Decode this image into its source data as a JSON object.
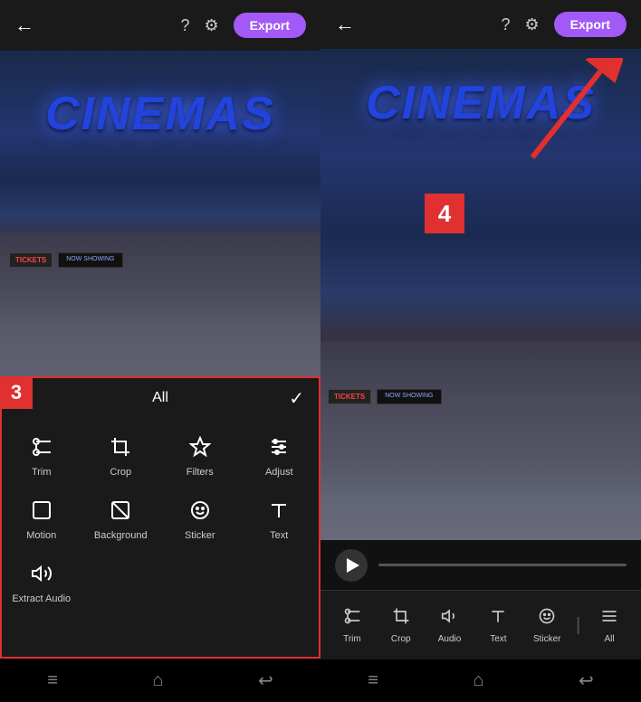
{
  "left": {
    "topBar": {
      "exportLabel": "Export"
    },
    "video": {
      "cinemas": "CINEMAS",
      "tickets": "TICKETS",
      "nowShowing": "NOW SHOWING"
    },
    "tools": {
      "headerTitle": "All",
      "stepBadge": "3",
      "items": [
        {
          "id": "trim",
          "icon": "✂",
          "label": "Trim"
        },
        {
          "id": "crop",
          "icon": "⊡",
          "label": "Crop"
        },
        {
          "id": "filters",
          "icon": "✳",
          "label": "Filters"
        },
        {
          "id": "adjust",
          "icon": "≡",
          "label": "Adjust"
        },
        {
          "id": "motion",
          "icon": "⬜",
          "label": "Motion"
        },
        {
          "id": "background",
          "icon": "⊗",
          "label": "Background"
        },
        {
          "id": "sticker",
          "icon": "☺",
          "label": "Sticker"
        },
        {
          "id": "text",
          "icon": "T",
          "label": "Text"
        },
        {
          "id": "extract-audio",
          "icon": "🔊",
          "label": "Extract Audio"
        }
      ]
    },
    "bottomNav": [
      "≡",
      "⌂",
      "←"
    ]
  },
  "right": {
    "topBar": {
      "exportLabel": "Export"
    },
    "video": {
      "cinemas": "CINEMAS"
    },
    "stepBadge": "4",
    "toolbar": {
      "items": [
        {
          "id": "trim",
          "icon": "✂",
          "label": "Trim"
        },
        {
          "id": "crop",
          "icon": "⊡",
          "label": "Crop"
        },
        {
          "id": "audio",
          "icon": "🔊",
          "label": "Audio"
        },
        {
          "id": "text",
          "icon": "T",
          "label": "Text"
        },
        {
          "id": "sticker",
          "icon": "☺",
          "label": "Sticker"
        },
        {
          "id": "all",
          "icon": "≡",
          "label": "All"
        }
      ]
    },
    "bottomNav": [
      "≡",
      "⌂",
      "←"
    ]
  }
}
